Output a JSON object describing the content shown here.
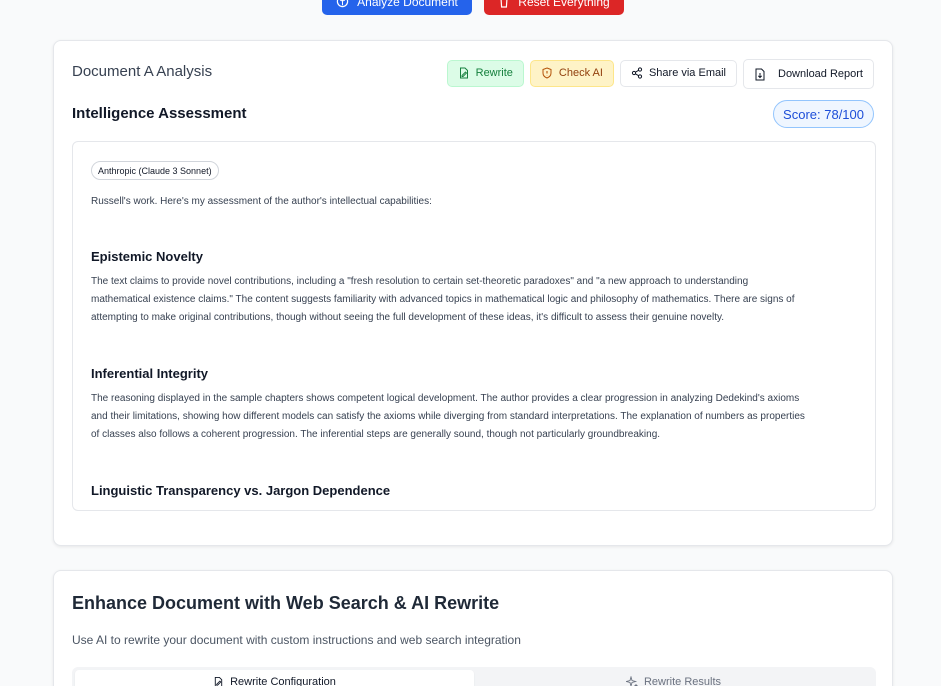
{
  "top_actions": {
    "analyze_label": "Analyze Document",
    "reset_label": "Reset Everything"
  },
  "document_card": {
    "title": "Document A Analysis",
    "toolbar": {
      "rewrite_label": "Rewrite",
      "check_ai_label": "Check AI",
      "share_label": "Share via Email",
      "download_label": "Download Report"
    },
    "section_title": "Intelligence Assessment",
    "score_label": "Score: 78/100",
    "analysis": {
      "model_tag": "Anthropic (Claude 3 Sonnet)",
      "intro": "Russell's work. Here's my assessment of the author's intellectual capabilities:",
      "sections": [
        {
          "heading": "Epistemic Novelty",
          "lines": [
            "The text claims to provide novel contributions, including a \"fresh resolution to certain set-theoretic paradoxes\" and \"a new approach to understanding",
            "mathematical existence claims.\" The content suggests familiarity with advanced topics in mathematical logic and philosophy of mathematics. There are signs of",
            "attempting to make original contributions, though without seeing the full development of these ideas, it's difficult to assess their genuine novelty."
          ]
        },
        {
          "heading": "Inferential Integrity",
          "lines": [
            "The reasoning displayed in the sample chapters shows competent logical development. The author provides a clear progression in analyzing Dedekind's axioms",
            "and their limitations, showing how different models can satisfy the axioms while diverging from standard interpretations. The explanation of numbers as properties",
            "of classes also follows a coherent progression. The inferential steps are generally sound, though not particularly groundbreaking."
          ]
        },
        {
          "heading": "Linguistic Transparency vs. Jargon Dependence",
          "lines": []
        }
      ]
    }
  },
  "enhance_card": {
    "title": "Enhance Document with Web Search & AI Rewrite",
    "subtitle": "Use AI to rewrite your document with custom instructions and web search integration",
    "tabs": [
      {
        "label": "Rewrite Configuration",
        "active": true
      },
      {
        "label": "Rewrite Results",
        "active": false
      }
    ]
  },
  "colors": {
    "primary": "#2563eb",
    "danger": "#dc2626",
    "rewrite_bg": "#dcfce7",
    "check_ai_bg": "#fef3c7",
    "score": "#1d4ed8"
  },
  "icons": {
    "analyze": "brain-icon",
    "reset": "trash-icon",
    "rewrite": "file-edit-icon",
    "check_ai": "shield-icon",
    "share": "share-icon",
    "download": "file-download-icon",
    "tab_config": "file-edit-icon",
    "tab_results": "sparkles-icon"
  }
}
